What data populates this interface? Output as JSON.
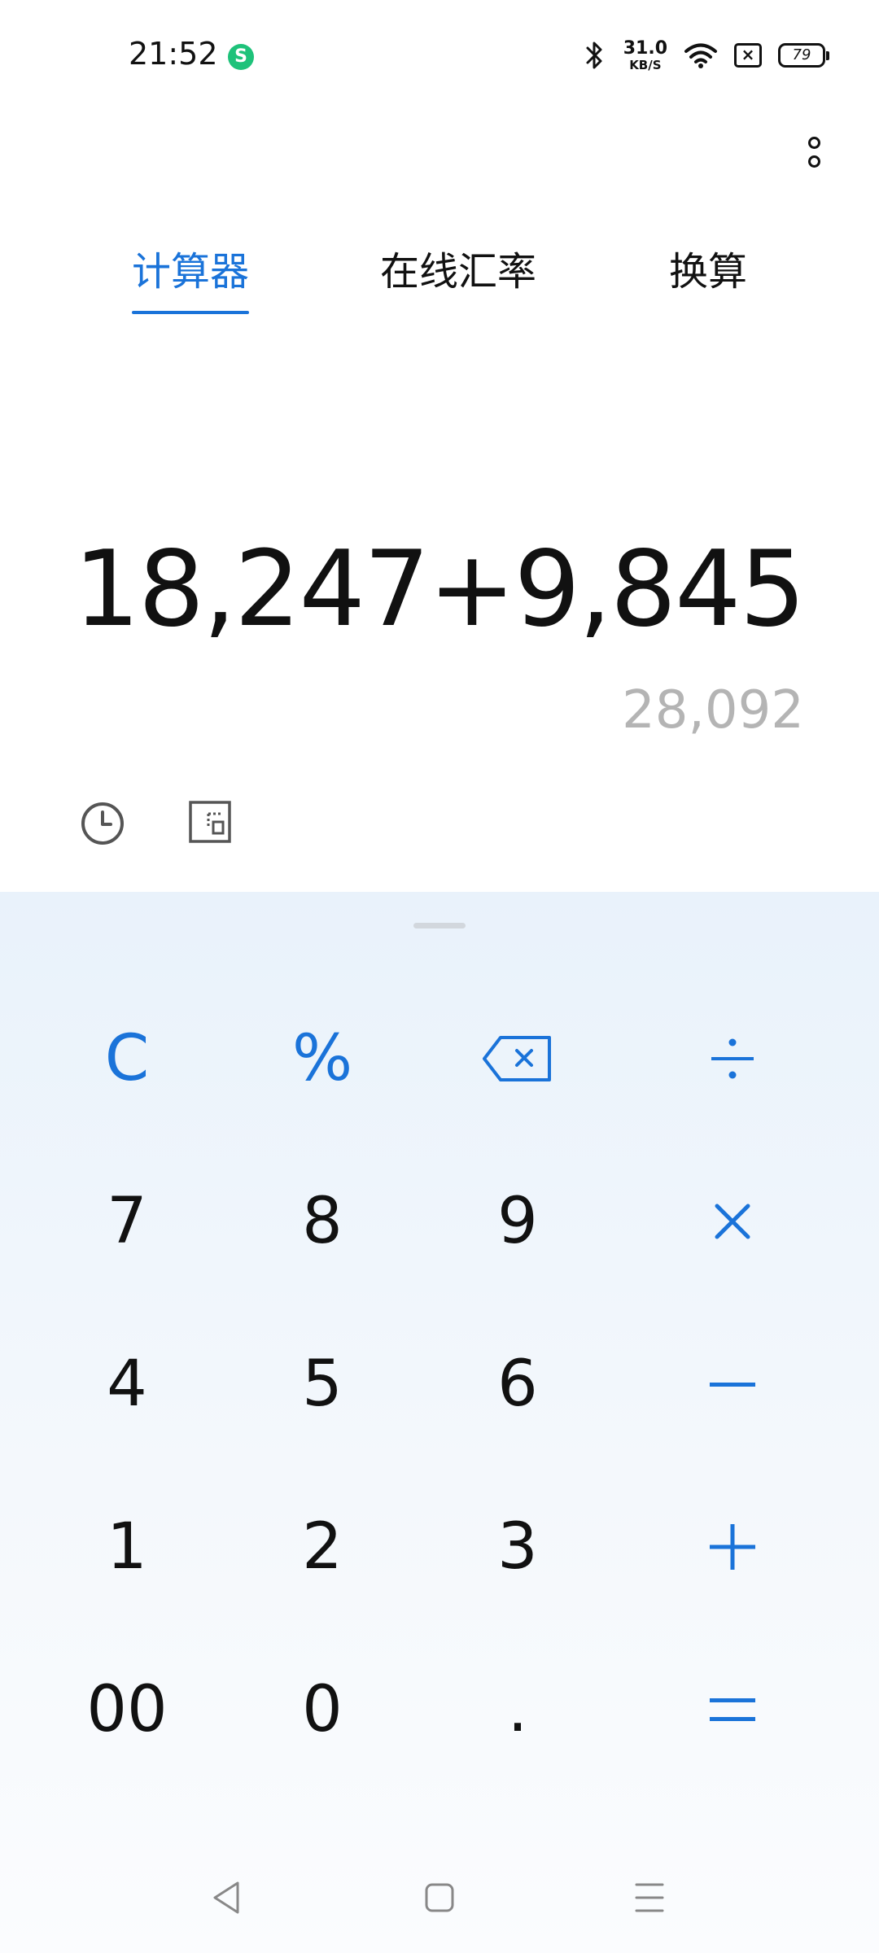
{
  "status_bar": {
    "time": "21:52",
    "app_indicator": "S",
    "net_speed_value": "31.0",
    "net_speed_unit": "KB/S",
    "battery_level": "79"
  },
  "tabs": [
    {
      "label": "计算器",
      "active": true
    },
    {
      "label": "在线汇率",
      "active": false
    },
    {
      "label": "换算",
      "active": false
    }
  ],
  "display": {
    "expression": "18,247+9,845",
    "result": "28,092"
  },
  "keypad": {
    "clear": "C",
    "percent": "%",
    "seven": "7",
    "eight": "8",
    "nine": "9",
    "four": "4",
    "five": "5",
    "six": "6",
    "one": "1",
    "two": "2",
    "three": "3",
    "double_zero": "00",
    "zero": "0",
    "decimal": "."
  },
  "colors": {
    "accent": "#1a73d9",
    "result_gray": "#b4b4b4",
    "keypad_bg": "#eef4fb"
  }
}
